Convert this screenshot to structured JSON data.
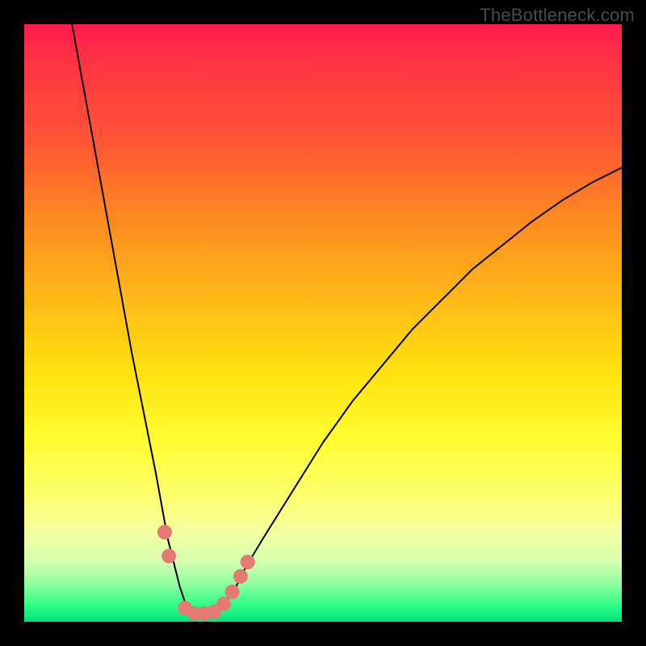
{
  "watermark": "TheBottleneck.com",
  "chart_data": {
    "type": "line",
    "title": "",
    "xlabel": "",
    "ylabel": "",
    "xlim": [
      0,
      100
    ],
    "ylim": [
      0,
      100
    ],
    "grid": false,
    "legend": false,
    "colors": {
      "bg_top": "#ff1a4d",
      "bg_mid": "#fff04d",
      "bg_bottom": "#00e27a",
      "line": "#000000",
      "marker": "#e37b72"
    },
    "series": [
      {
        "name": "bottleneck-curve",
        "x": [
          8,
          10,
          12,
          14,
          16,
          18,
          20,
          22,
          24,
          25,
          26,
          27,
          28,
          29,
          30,
          31,
          32,
          33,
          35,
          37,
          40,
          45,
          50,
          55,
          60,
          65,
          70,
          75,
          80,
          85,
          90,
          95,
          100
        ],
        "values": [
          100,
          89,
          78,
          67,
          56,
          45,
          35,
          25,
          14,
          10,
          6,
          3,
          1.5,
          1,
          1,
          1,
          1.5,
          2.5,
          5,
          9,
          14,
          22,
          30,
          37,
          43,
          49,
          54,
          59,
          63,
          67,
          70.5,
          73.5,
          76
        ]
      }
    ],
    "markers": [
      {
        "x": 23.5,
        "y": 15
      },
      {
        "x": 24.2,
        "y": 11
      },
      {
        "x": 26.9,
        "y": 2.3
      },
      {
        "x": 28.5,
        "y": 1.4
      },
      {
        "x": 30.2,
        "y": 1.4
      },
      {
        "x": 31.8,
        "y": 1.7
      },
      {
        "x": 33.4,
        "y": 3.0
      },
      {
        "x": 34.8,
        "y": 5.0
      },
      {
        "x": 36.2,
        "y": 7.6
      },
      {
        "x": 37.4,
        "y": 10.0
      }
    ],
    "marker_radius_px": 9
  }
}
